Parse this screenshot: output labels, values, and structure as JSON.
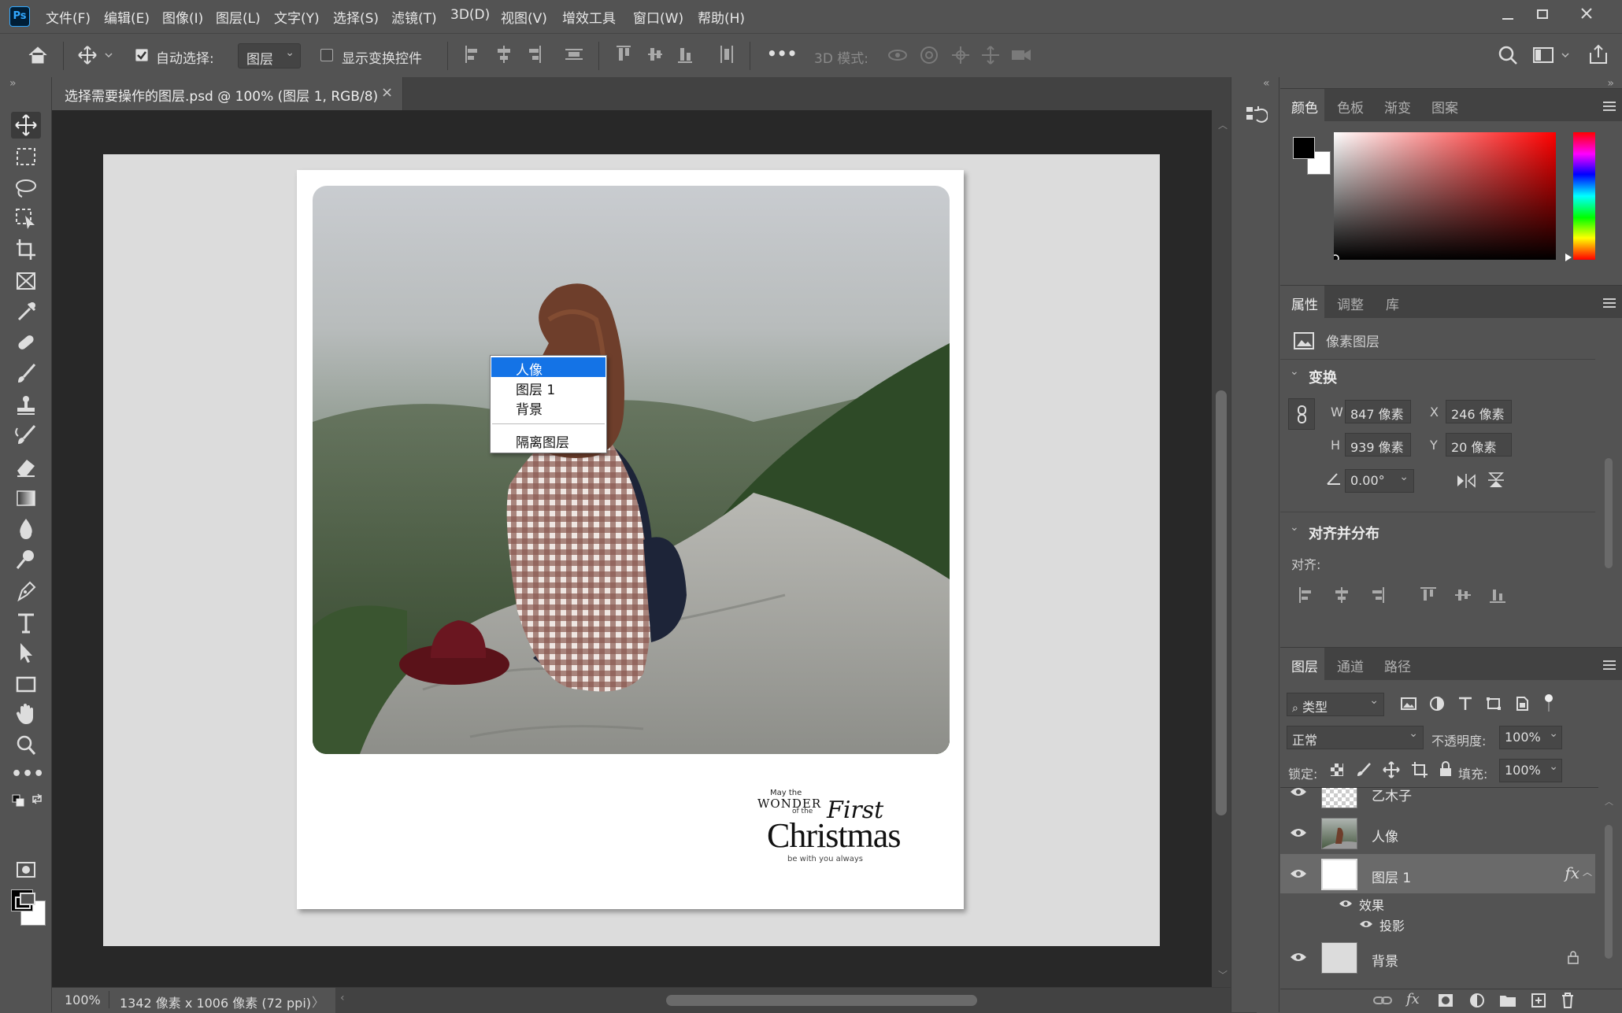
{
  "app": {
    "logo": "Ps",
    "menu": [
      "文件(F)",
      "编辑(E)",
      "图像(I)",
      "图层(L)",
      "文字(Y)",
      "选择(S)",
      "滤镜(T)",
      "3D(D)",
      "视图(V)",
      "增效工具",
      "窗口(W)",
      "帮助(H)"
    ],
    "window_controls": [
      "minimize-icon",
      "restore-icon",
      "close-icon"
    ]
  },
  "options": {
    "auto_select_label": "自动选择:",
    "auto_select_checked": true,
    "auto_select_target": "图层",
    "show_transform_label": "显示变换控件",
    "show_transform_checked": false,
    "more": "•••",
    "mode_3d_label": "3D 模式:"
  },
  "document": {
    "tab_title": "选择需要操作的图层.psd @ 100% (图层 1, RGB/8)",
    "close": "×"
  },
  "canvas": {
    "card_text_small_top": "May the",
    "card_text_wonder": "WONDER",
    "card_text_ofthe": "of the",
    "card_text_first": "First",
    "card_text_christmas": "Christmas",
    "card_text_bottom": "be with you always"
  },
  "context_menu": {
    "items": [
      "人像",
      "图层 1",
      "背景"
    ],
    "selected_index": 0,
    "extra_item": "隔离图层"
  },
  "status": {
    "zoom": "100%",
    "doc_info": "1342 像素 x 1006 像素 (72 ppi)",
    "arrow": "〉"
  },
  "color_panel": {
    "tabs": [
      "颜色",
      "色板",
      "渐变",
      "图案"
    ],
    "active_tab": "颜色",
    "foreground": "#000000",
    "background": "#ffffff"
  },
  "properties_panel": {
    "tabs": [
      "属性",
      "调整",
      "库"
    ],
    "active_tab": "属性",
    "layer_kind": "像素图层",
    "transform_title": "变换",
    "w_label": "W",
    "w_value": "847 像素",
    "x_label": "X",
    "x_value": "246 像素",
    "h_label": "H",
    "h_value": "939 像素",
    "y_label": "Y",
    "y_value": "20 像素",
    "angle_value": "0.00°",
    "align_title": "对齐并分布",
    "align_label": "对齐:"
  },
  "layers_panel": {
    "tabs": [
      "图层",
      "通道",
      "路径"
    ],
    "active_tab": "图层",
    "filter_kind": "类型",
    "blend_mode": "正常",
    "opacity_label": "不透明度:",
    "opacity_value": "100%",
    "lock_label": "锁定:",
    "fill_label": "填充:",
    "fill_value": "100%",
    "layers": [
      {
        "name": "乙木子",
        "visible": true
      },
      {
        "name": "人像",
        "visible": true
      },
      {
        "name": "图层 1",
        "visible": true,
        "selected": true,
        "fx": "fx"
      },
      {
        "name": "背景",
        "visible": true,
        "locked": true
      }
    ],
    "effects_label": "效果",
    "shadow_label": "投影"
  }
}
